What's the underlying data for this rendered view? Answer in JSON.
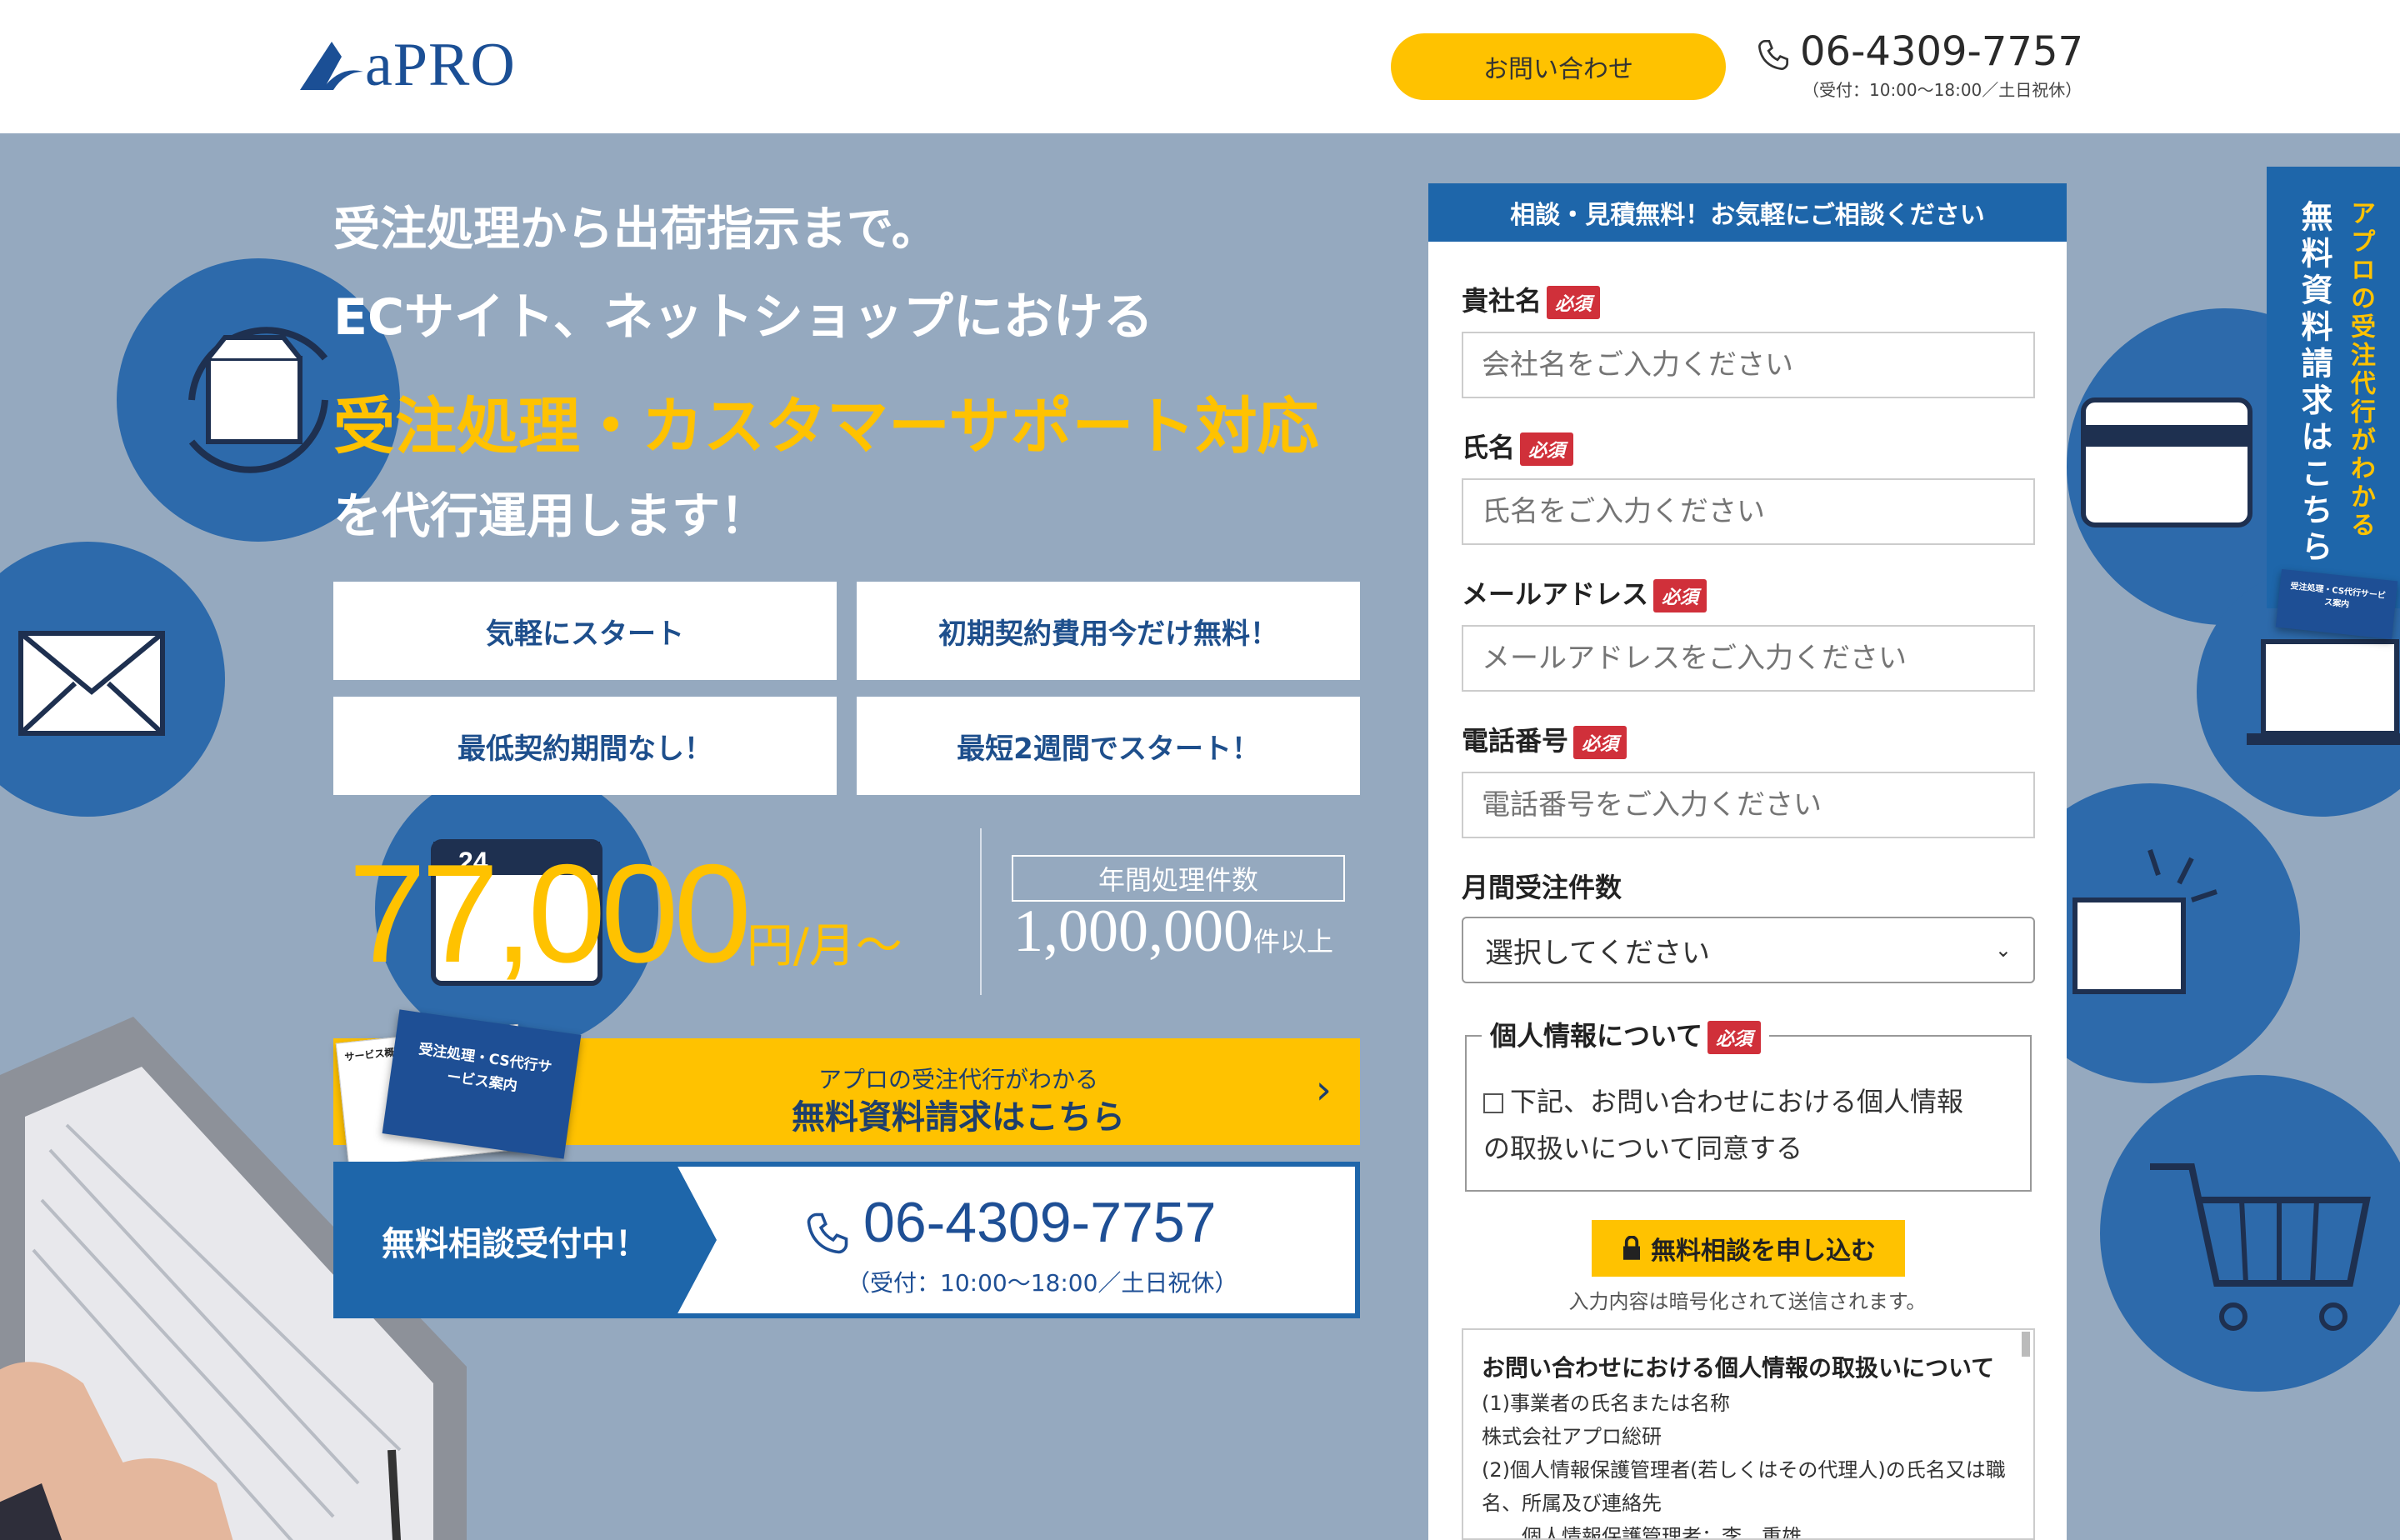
{
  "header": {
    "logo_text": "aPRO",
    "contact_button": "お問い合わせ",
    "phone": "06-4309-7757",
    "hours": "（受付：10:00〜18:00／土日祝休）"
  },
  "hero": {
    "line1": "受注処理から出荷指示まで。",
    "line2": "ECサイト、ネットショップにおける",
    "line3": "受注処理・カスタマーサポート対応",
    "line4": "を代行運用します！",
    "features": [
      "気軽にスタート",
      "初期契約費用今だけ無料！",
      "最低契約期間なし！",
      "最短2週間でスタート！"
    ],
    "price": "77,000",
    "price_unit": "円/月〜",
    "annual_label": "年間処理件数",
    "annual_value": "1,000,000",
    "annual_unit": "件以上",
    "doc_sub": "アプロの受注代行がわかる",
    "doc_main": "無料資料請求はこちら",
    "brochure_title": "受注処理・CS代行サービス案内",
    "brochure_small": "サービス概要",
    "consult_label": "無料相談受付中！",
    "consult_phone": "06-4309-7757",
    "consult_hours": "（受付：10:00〜18:00／土日祝休）",
    "deco_number": "24"
  },
  "form": {
    "header": "相談・見積無料！お気軽にご相談ください",
    "required": "必須",
    "fields": [
      {
        "label": "貴社名",
        "placeholder": "会社名をご入力ください"
      },
      {
        "label": "氏名",
        "placeholder": "氏名をご入力ください"
      },
      {
        "label": "メールアドレス",
        "placeholder": "メールアドレスをご入力ください"
      },
      {
        "label": "電話番号",
        "placeholder": "電話番号をご入力ください"
      }
    ],
    "monthly_label": "月間受注件数",
    "monthly_select": "選択してください",
    "privacy_legend": "個人情報について",
    "privacy_line1": "下記、お問い合わせにおける個人情報",
    "privacy_line2": "の取扱いについて同意する",
    "submit": "無料相談を申し込む",
    "encrypted": "入力内容は暗号化されて送信されます。",
    "policy_title": "お問い合わせにおける個人情報の取扱いについて",
    "policy_lines": [
      "(1)事業者の氏名または名称",
      "株式会社アプロ総研",
      "(2)個人情報保護管理者(若しくはその代理人)の氏名又は職名、所属及び連絡先",
      "　　個人情報保護管理者：李　重雄"
    ]
  },
  "side_tab": {
    "sub": "アプロの受注代行がわかる",
    "main": "無料資料請求はこちら"
  },
  "colors": {
    "primary": "#1e66aa",
    "accent": "#ffc200",
    "hero_bg": "#95a9bf"
  }
}
